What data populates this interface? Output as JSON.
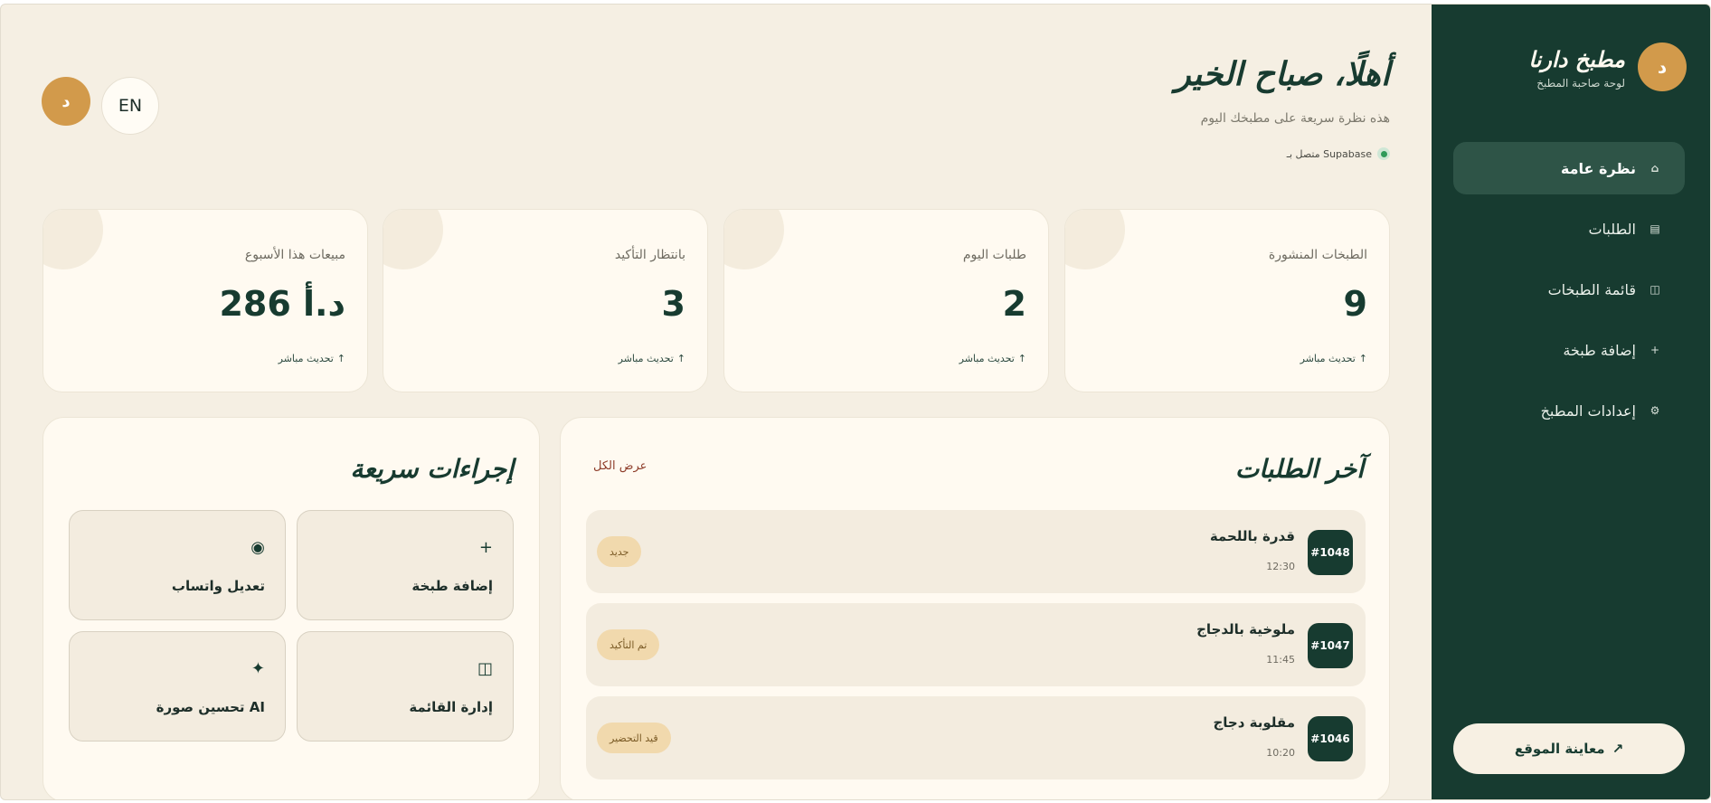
{
  "sidebar": {
    "avatar_letter": "د",
    "brand_name": "مطبخ دارنا",
    "brand_sub": "لوحة صاحبة المطبخ",
    "items": [
      {
        "label": "نظرة عامة",
        "icon": "⌂",
        "icon_name": "home-icon",
        "active": true
      },
      {
        "label": "الطلبات",
        "icon": "▤",
        "icon_name": "receipt-icon",
        "active": false
      },
      {
        "label": "قائمة الطبخات",
        "icon": "◫",
        "icon_name": "menu-book-icon",
        "active": false
      },
      {
        "label": "إضافة طبخة",
        "icon": "+",
        "icon_name": "plus-icon",
        "active": false
      },
      {
        "label": "إعدادات المطبخ",
        "icon": "⚙",
        "icon_name": "gear-icon",
        "active": false
      }
    ],
    "preview_label": "معاينة الموقع",
    "preview_icon": "↗"
  },
  "header": {
    "title": "أهلًا، صباح الخير",
    "subtitle": "هذه نظرة سريعة على مطبخك اليوم",
    "connection": "متصل بـ Supabase",
    "lang_button": "EN",
    "user_avatar": "د"
  },
  "stats": [
    {
      "label": "الطبخات المنشورة",
      "value": "9",
      "foot": "تحديث مباشر",
      "foot_icon": "↑"
    },
    {
      "label": "طلبات اليوم",
      "value": "2",
      "foot": "تحديث مباشر",
      "foot_icon": "↑"
    },
    {
      "label": "بانتظار التأكيد",
      "value": "3",
      "foot": "تحديث مباشر",
      "foot_icon": "↑"
    },
    {
      "label": "مبيعات هذا الأسبوع",
      "value": "286 د.أ",
      "foot": "تحديث مباشر",
      "foot_icon": "↑"
    }
  ],
  "orders": {
    "title": "آخر الطلبات",
    "view_all": "عرض الكل",
    "rows": [
      {
        "id": "#1048",
        "name": "قدرة باللحمة",
        "time": "12:30",
        "status": "جديد"
      },
      {
        "id": "#1047",
        "name": "ملوخية بالدجاج",
        "time": "11:45",
        "status": "تم التأكيد"
      },
      {
        "id": "#1046",
        "name": "مقلوبة دجاج",
        "time": "10:20",
        "status": "قيد التحضير"
      }
    ]
  },
  "actions": {
    "title": "إجراءات سريعة",
    "items": [
      {
        "label": "إضافة طبخة",
        "icon": "+",
        "icon_name": "plus-icon"
      },
      {
        "label": "تعديل واتساب",
        "icon": "◉",
        "icon_name": "whatsapp-icon"
      },
      {
        "label": "إدارة القائمة",
        "icon": "◫",
        "icon_name": "menu-book-icon"
      },
      {
        "label": "تحسين صورة AI",
        "icon": "✦",
        "icon_name": "sparkle-icon"
      }
    ]
  }
}
